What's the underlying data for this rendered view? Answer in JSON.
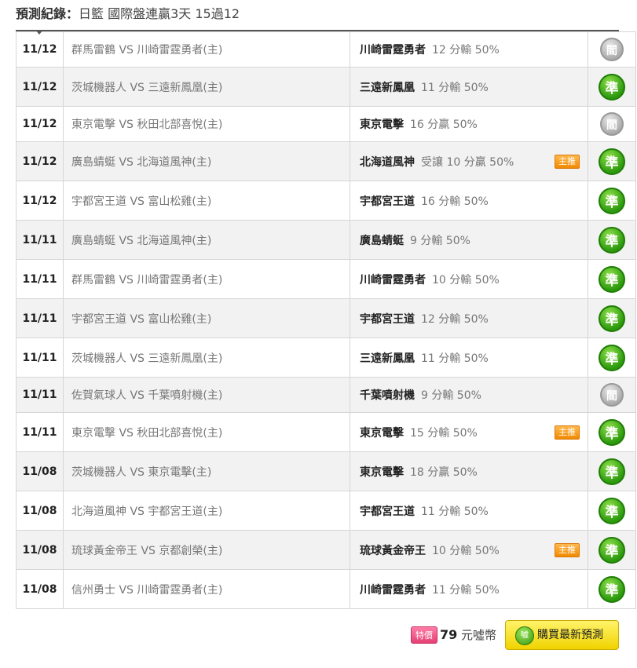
{
  "header": {
    "label": "預測紀錄：",
    "title": "日籃 國際盤連贏3天 15過12"
  },
  "rows": [
    {
      "date": "11/12",
      "match": "群馬雷鶴 VS 川崎雷霆勇者(主)",
      "team": "川崎雷霆勇者",
      "odds": "12 分輸 50%",
      "badge": "",
      "result": "閻",
      "status": "void"
    },
    {
      "date": "11/12",
      "match": "茨城機器人 VS 三遠新鳳凰(主)",
      "team": "三遠新鳳凰",
      "odds": "11 分輸 50%",
      "badge": "",
      "result": "準",
      "status": "win"
    },
    {
      "date": "11/12",
      "match": "東京電擊 VS 秋田北部喜悅(主)",
      "team": "東京電擊",
      "odds": "16 分贏 50%",
      "badge": "",
      "result": "閻",
      "status": "void"
    },
    {
      "date": "11/12",
      "match": "廣島蜻蜓 VS 北海道風神(主)",
      "team": "北海道風神",
      "odds": "受讓 10 分贏 50%",
      "badge": "主推",
      "result": "準",
      "status": "win"
    },
    {
      "date": "11/12",
      "match": "宇都宮王道 VS 富山松雞(主)",
      "team": "宇都宮王道",
      "odds": "16 分輸 50%",
      "badge": "",
      "result": "準",
      "status": "win"
    },
    {
      "date": "11/11",
      "match": "廣島蜻蜓 VS 北海道風神(主)",
      "team": "廣島蜻蜓",
      "odds": "9 分輸 50%",
      "badge": "",
      "result": "準",
      "status": "win"
    },
    {
      "date": "11/11",
      "match": "群馬雷鶴 VS 川崎雷霆勇者(主)",
      "team": "川崎雷霆勇者",
      "odds": "10 分輸 50%",
      "badge": "",
      "result": "準",
      "status": "win"
    },
    {
      "date": "11/11",
      "match": "宇都宮王道 VS 富山松雞(主)",
      "team": "宇都宮王道",
      "odds": "12 分輸 50%",
      "badge": "",
      "result": "準",
      "status": "win"
    },
    {
      "date": "11/11",
      "match": "茨城機器人 VS 三遠新鳳凰(主)",
      "team": "三遠新鳳凰",
      "odds": "11 分輸 50%",
      "badge": "",
      "result": "準",
      "status": "win"
    },
    {
      "date": "11/11",
      "match": "佐賀氣球人 VS 千葉噴射機(主)",
      "team": "千葉噴射機",
      "odds": "9 分輸 50%",
      "badge": "",
      "result": "閻",
      "status": "void"
    },
    {
      "date": "11/11",
      "match": "東京電擊 VS 秋田北部喜悅(主)",
      "team": "東京電擊",
      "odds": "15 分輸 50%",
      "badge": "主推",
      "result": "準",
      "status": "win"
    },
    {
      "date": "11/08",
      "match": "茨城機器人 VS 東京電擊(主)",
      "team": "東京電擊",
      "odds": "18 分贏 50%",
      "badge": "",
      "result": "準",
      "status": "win"
    },
    {
      "date": "11/08",
      "match": "北海道風神 VS 宇都宮王道(主)",
      "team": "宇都宮王道",
      "odds": "11 分輸 50%",
      "badge": "",
      "result": "準",
      "status": "win"
    },
    {
      "date": "11/08",
      "match": "琉球黃金帝王 VS 京都創榮(主)",
      "team": "琉球黃金帝王",
      "odds": "10 分輸 50%",
      "badge": "主推",
      "result": "準",
      "status": "win"
    },
    {
      "date": "11/08",
      "match": "信州勇士 VS 川崎雷霆勇者(主)",
      "team": "川崎雷霆勇者",
      "odds": "11 分輸 50%",
      "badge": "",
      "result": "準",
      "status": "win"
    }
  ],
  "row_heights": [
    45,
    50,
    45,
    50,
    50,
    50,
    50,
    50,
    50,
    45,
    50,
    50,
    50,
    50,
    50
  ],
  "footer": {
    "special_badge": "特價",
    "price_value": "79",
    "price_unit": "元噓幣",
    "buy_icon": "噓",
    "buy_label": "購買最新預測"
  }
}
